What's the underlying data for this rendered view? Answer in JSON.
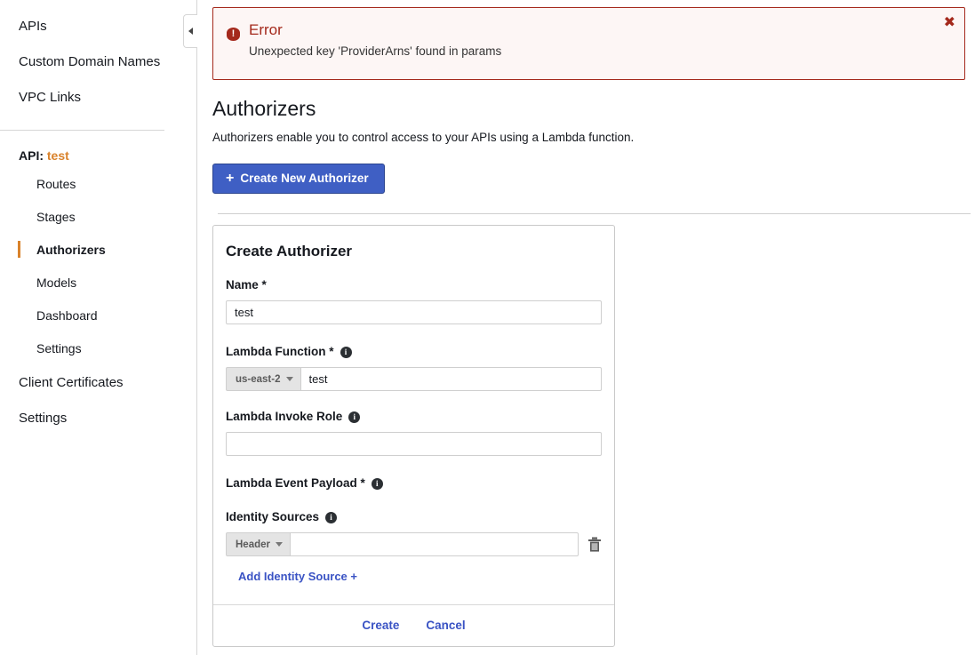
{
  "sidebar": {
    "top_items": [
      {
        "label": "APIs"
      },
      {
        "label": "Custom Domain Names"
      },
      {
        "label": "VPC Links"
      }
    ],
    "api_section": {
      "prefix": "API:",
      "name": "test"
    },
    "api_items": [
      {
        "label": "Routes",
        "active": false
      },
      {
        "label": "Stages",
        "active": false
      },
      {
        "label": "Authorizers",
        "active": true
      },
      {
        "label": "Models",
        "active": false
      },
      {
        "label": "Dashboard",
        "active": false
      },
      {
        "label": "Settings",
        "active": false
      }
    ],
    "root_items": [
      {
        "label": "Client Certificates"
      },
      {
        "label": "Settings"
      }
    ],
    "collapse_handle_icon": "caret-left-icon"
  },
  "alert": {
    "icon": "error-icon",
    "title": "Error",
    "message": "Unexpected key 'ProviderArns' found in params",
    "close_label": "✖",
    "border_color": "#a4291c",
    "text_color": "#a4291c",
    "background": "#fdf6f5"
  },
  "main": {
    "title": "Authorizers",
    "description": "Authorizers enable you to control access to your APIs using a Lambda function.",
    "create_button": {
      "icon": "plus-icon",
      "plus": "＋",
      "label": "Create New Authorizer",
      "color": "#3f5fc4"
    }
  },
  "form": {
    "title": "Create Authorizer",
    "name": {
      "label": "Name *",
      "value": "test",
      "placeholder": ""
    },
    "lambda_function": {
      "label": "Lambda Function *",
      "info_icon": "info-icon",
      "region": "us-east-2",
      "value": "test",
      "placeholder": ""
    },
    "lambda_invoke_role": {
      "label": "Lambda Invoke Role",
      "info_icon": "info-icon",
      "value": "",
      "placeholder": ""
    },
    "lambda_event_payload": {
      "label": "Lambda Event Payload *",
      "info_icon": "info-icon"
    },
    "identity_sources": {
      "label": "Identity Sources",
      "info_icon": "info-icon",
      "rows": [
        {
          "type": "Header",
          "value": "",
          "placeholder": "",
          "delete_icon": "trash-icon"
        }
      ],
      "add_label": "Add Identity Source +"
    },
    "actions": {
      "create_label": "Create",
      "cancel_label": "Cancel",
      "link_color": "#3a53c4"
    }
  }
}
